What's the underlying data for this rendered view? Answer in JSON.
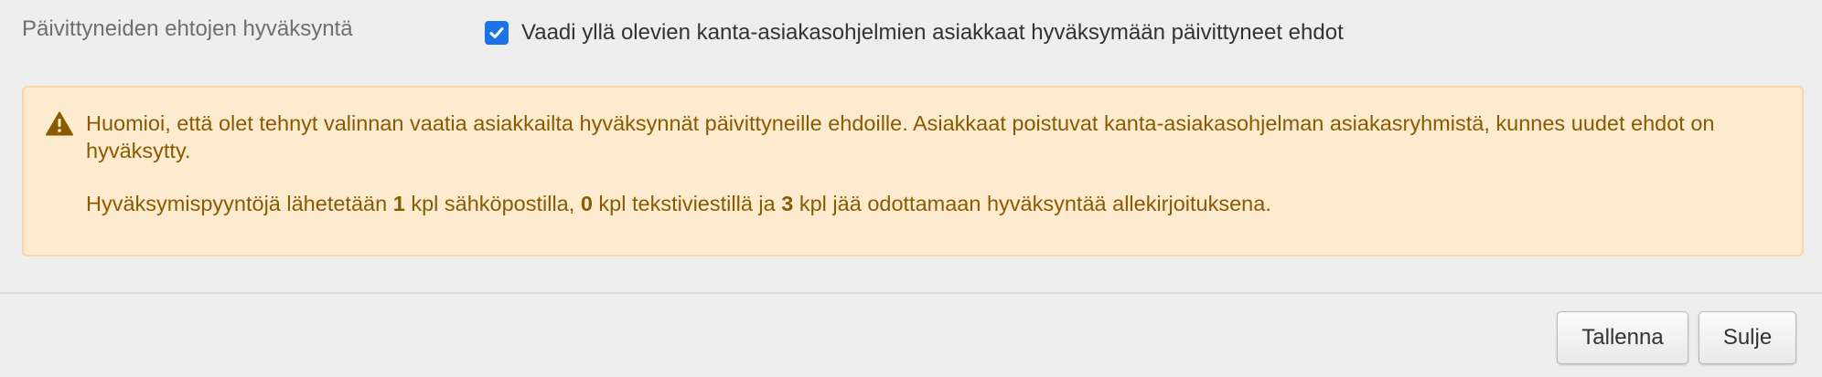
{
  "form": {
    "terms_label": "Päivittyneiden ehtojen hyväksyntä",
    "require_checkbox": {
      "checked": true,
      "label": "Vaadi yllä olevien kanta-asiakasohjelmien asiakkaat hyväksymään päivittyneet ehdot"
    }
  },
  "alert": {
    "icon": "warning-icon",
    "message": "Huomioi, että olet tehnyt valinnan vaatia asiakkailta hyväksynnät päivittyneille ehdoille. Asiakkaat poistuvat kanta-asiakasohjelman asiakasryhmistä, kunnes uudet ehdot on hyväksytty.",
    "summary": {
      "prefix": "Hyväksymispyyntöjä lähetetään",
      "email_count": "1",
      "email_text": "kpl sähköpostilla,",
      "sms_count": "0",
      "sms_text": "kpl tekstiviestillä ja",
      "signature_count": "3",
      "signature_text": "kpl jää odottamaan hyväksyntää allekirjoituksena."
    }
  },
  "footer": {
    "save_label": "Tallenna",
    "close_label": "Sulje"
  },
  "colors": {
    "background": "#eeeeee",
    "checkbox": "#1a73e8",
    "alert_background": "#fdebcf",
    "alert_border": "#f6d7a7",
    "alert_text": "#8a5a00"
  }
}
